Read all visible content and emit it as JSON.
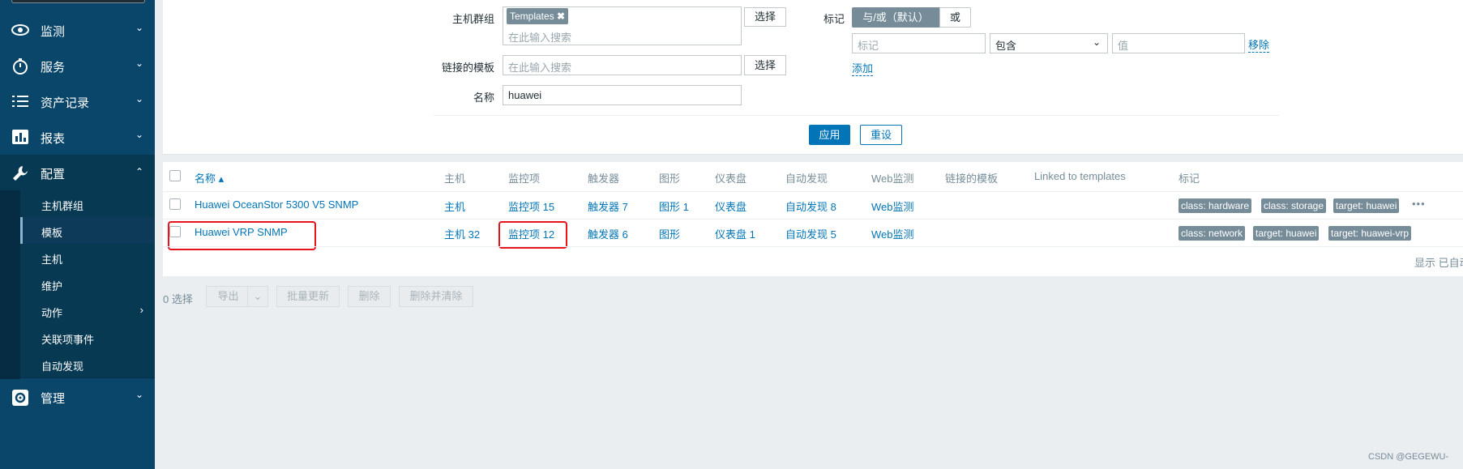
{
  "sidebar": {
    "items": [
      {
        "label": "监测",
        "icon": "eye-icon"
      },
      {
        "label": "服务",
        "icon": "stopwatch-icon"
      },
      {
        "label": "资产记录",
        "icon": "list-icon"
      },
      {
        "label": "报表",
        "icon": "bar-chart-icon"
      },
      {
        "label": "配置",
        "icon": "wrench-icon"
      },
      {
        "label": "管理",
        "icon": "gear-icon"
      }
    ],
    "config_sub": [
      {
        "label": "主机群组"
      },
      {
        "label": "模板"
      },
      {
        "label": "主机"
      },
      {
        "label": "维护"
      },
      {
        "label": "动作"
      },
      {
        "label": "关联项事件"
      },
      {
        "label": "自动发现"
      }
    ]
  },
  "filter": {
    "host_group_label": "主机群组",
    "host_group_chip": "Templates",
    "host_group_placeholder": "在此输入搜索",
    "select_label": "选择",
    "linked_templates_label": "链接的模板",
    "linked_templates_placeholder": "在此输入搜索",
    "name_label": "名称",
    "name_value": "huawei",
    "tags_label": "标记",
    "and_or": "与/或（默认）",
    "or": "或",
    "tag_placeholder": "标记",
    "operator": "包含",
    "value_placeholder": "值",
    "remove": "移除",
    "add": "添加",
    "apply": "应用",
    "reset": "重设"
  },
  "table": {
    "headers": {
      "name": "名称 ▴",
      "hosts": "主机",
      "items": "监控项",
      "triggers": "触发器",
      "graphs": "图形",
      "dashboards": "仪表盘",
      "discovery": "自动发现",
      "web": "Web监测",
      "linked": "链接的模板",
      "linked_to": "Linked to templates",
      "tags": "标记"
    },
    "rows": [
      {
        "name": "Huawei OceanStor 5300 V5 SNMP",
        "hosts": "主机",
        "items": "监控项 15",
        "triggers": "触发器 7",
        "graphs": "图形 1",
        "dashboards": "仪表盘",
        "discovery": "自动发现 8",
        "web": "Web监测",
        "tags": [
          "class: hardware",
          "class: storage",
          "target: huawei"
        ],
        "more": "•••"
      },
      {
        "name": "Huawei VRP SNMP",
        "hosts": "主机 32",
        "items": "监控项 12",
        "triggers": "触发器 6",
        "graphs": "图形",
        "dashboards": "仪表盘 1",
        "discovery": "自动发现 5",
        "web": "Web监测",
        "tags": [
          "class: network",
          "target: huawei",
          "target: huawei-vrp"
        ]
      }
    ],
    "footer": "显示 已自动"
  },
  "bulk": {
    "selected": "0 选择",
    "export": "导出",
    "mass_update": "批量更新",
    "delete": "删除",
    "delete_clear": "删除并清除"
  },
  "watermark": "CSDN @GEGEWU-",
  "colors": {
    "sidebar": "#0a466a",
    "link": "#0275b8",
    "tag": "#768d99",
    "highlight": "#e8141b"
  }
}
